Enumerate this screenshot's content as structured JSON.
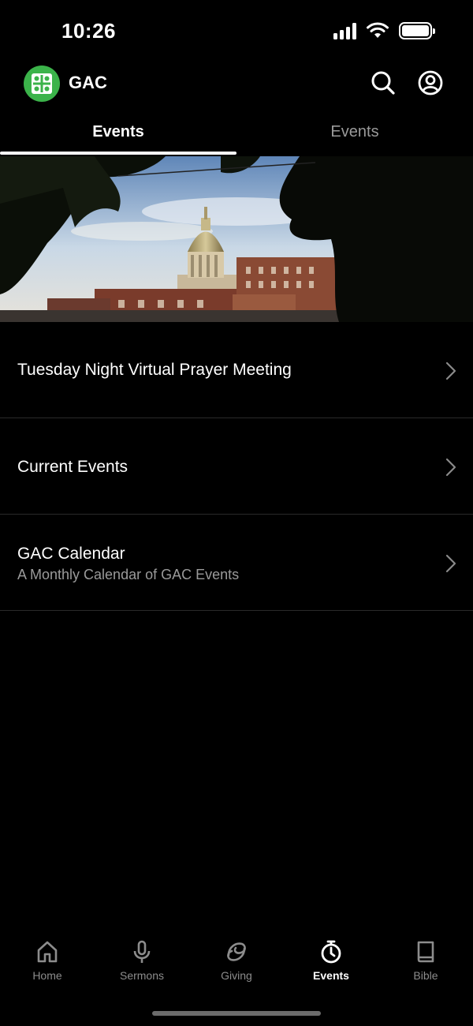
{
  "status_bar": {
    "time": "10:26"
  },
  "header": {
    "app_name": "GAC",
    "logo_icon": "gac-logo",
    "search_icon": "search-icon",
    "profile_icon": "profile-icon"
  },
  "tabs": [
    {
      "label": "Events",
      "active": true
    },
    {
      "label": "Events",
      "active": false
    }
  ],
  "banner": {
    "description_icon": "capitol-dome-photo"
  },
  "list": [
    {
      "title": "Tuesday Night Virtual Prayer Meeting",
      "subtitle": ""
    },
    {
      "title": "Current Events",
      "subtitle": ""
    },
    {
      "title": "GAC Calendar",
      "subtitle": "A Monthly Calendar of GAC Events"
    }
  ],
  "tabbar": [
    {
      "label": "Home",
      "icon": "home-icon",
      "active": false
    },
    {
      "label": "Sermons",
      "icon": "microphone-icon",
      "active": false
    },
    {
      "label": "Giving",
      "icon": "giving-icon",
      "active": false
    },
    {
      "label": "Events",
      "icon": "stopwatch-icon",
      "active": true
    },
    {
      "label": "Bible",
      "icon": "book-icon",
      "active": false
    }
  ],
  "colors": {
    "background": "#000000",
    "accent_logo": "#3bb34a",
    "inactive_text": "#9a9a9a"
  }
}
